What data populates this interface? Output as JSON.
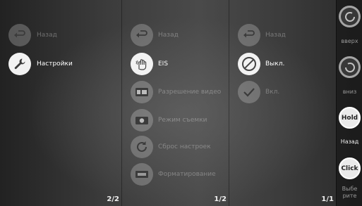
{
  "panel1": {
    "items": [
      {
        "label": "Назад",
        "icon": "back-arrow-icon",
        "state": "dim"
      },
      {
        "label": "Настройки",
        "icon": "wrench-icon",
        "state": "selected"
      }
    ],
    "page": "2/2"
  },
  "panel2": {
    "items": [
      {
        "label": "Назад",
        "icon": "back-arrow-icon",
        "state": "dim"
      },
      {
        "label": "EIS",
        "icon": "hand-stabilization-icon",
        "state": "selected"
      },
      {
        "label": "Разрешение видео",
        "icon": "video-resolution-icon",
        "state": "dim"
      },
      {
        "label": "Режим съемки",
        "icon": "camera-mode-icon",
        "state": "dim"
      },
      {
        "label": "Сброс настроек",
        "icon": "reset-icon",
        "state": "dim"
      },
      {
        "label": "Форматирование",
        "icon": "format-icon",
        "state": "dim"
      }
    ],
    "page": "1/2"
  },
  "panel3": {
    "items": [
      {
        "label": "Назад",
        "icon": "back-arrow-icon",
        "state": "dim"
      },
      {
        "label": "Выкл.",
        "icon": "off-circle-icon",
        "state": "selected"
      },
      {
        "label": "Вкл.",
        "icon": "checkmark-icon",
        "state": "dim"
      }
    ],
    "page": "1/1"
  },
  "sidebar": {
    "up_label": "вверх",
    "down_label": "вниз",
    "hold_text": "Hold",
    "hold_label": "Назад",
    "click_text": "Click",
    "click_label_line1": "Выбе",
    "click_label_line2": "рите"
  },
  "colors": {
    "selected_circle": "#f2f2f2",
    "dim_circle": "rgba(220,220,220,0.28)",
    "selected_text": "#ffffff"
  }
}
